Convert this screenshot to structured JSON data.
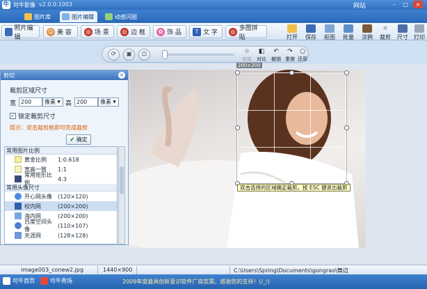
{
  "app": {
    "name": "可牛影像",
    "version": "v2.0.0.1003",
    "site": "网站"
  },
  "tabs": [
    {
      "label": "图片库"
    },
    {
      "label": "图片编辑"
    },
    {
      "label": "动感闪图"
    }
  ],
  "modules": [
    {
      "label": "照片编辑",
      "icon": "photo-edit-icon"
    },
    {
      "label": "美 容",
      "icon": "beauty-icon"
    },
    {
      "label": "场 景",
      "icon": "scene-icon"
    },
    {
      "label": "边 框",
      "icon": "frame-icon"
    },
    {
      "label": "饰 品",
      "icon": "ornament-icon"
    },
    {
      "label": "文 字",
      "icon": "text-icon"
    },
    {
      "label": "多图拼贴",
      "icon": "collage-icon"
    }
  ],
  "actions": [
    {
      "label": "打开",
      "icon": "open-icon"
    },
    {
      "label": "保存",
      "icon": "save-icon"
    },
    {
      "label": "抠图",
      "icon": "cutout-icon"
    },
    {
      "label": "批量",
      "icon": "batch-icon"
    },
    {
      "label": "涂鸦",
      "icon": "graffiti-icon"
    },
    {
      "label": "裁剪",
      "icon": "crop-icon"
    },
    {
      "label": "尺寸",
      "icon": "size-icon"
    },
    {
      "label": "打印",
      "icon": "print-icon"
    }
  ],
  "subtools": [
    {
      "label": "缩放",
      "icon": "zoom-icon"
    },
    {
      "label": "对比",
      "icon": "compare-icon"
    },
    {
      "label": "撤销",
      "icon": "undo-icon"
    },
    {
      "label": "重做",
      "icon": "redo-icon"
    },
    {
      "label": "还原",
      "icon": "restore-icon"
    }
  ],
  "crop": {
    "size_label": "200×200",
    "hint": "双击选择的区域确定裁剪，按 ESC 键退出裁剪"
  },
  "panel": {
    "title": "剪切",
    "section_title": "裁剪区域尺寸",
    "width_label": "宽",
    "width_value": "200",
    "height_label": "高",
    "height_value": "200",
    "unit": "像素",
    "lock_label": "锁定裁剪尺寸",
    "tip": "提示：双击裁剪框即可完成裁剪",
    "ok_label": "确定",
    "groups": [
      {
        "title": "常用图片比例",
        "items": [
          {
            "name": "黄金比例",
            "value": "1:0.618",
            "color": "#f3ef9a"
          },
          {
            "name": "宽高一致",
            "value": "1:1",
            "color": "#f7f3c8"
          },
          {
            "name": "常用矩形比例",
            "value": "4:3",
            "color": "#3a4a7a"
          }
        ]
      },
      {
        "title": "常用头像尺寸",
        "items": [
          {
            "name": "开心网头像",
            "value": "(120×120)",
            "color": "#4a8be0"
          },
          {
            "name": "校内网",
            "value": "(200×200)",
            "color": "#2f5fb0"
          },
          {
            "name": "海内网",
            "value": "(200×200)",
            "color": "#7aa6e0"
          },
          {
            "name": "百度空间头像",
            "value": "(110×107)",
            "color": "#4f7fd0"
          },
          {
            "name": "天涯网",
            "value": "(128×128)",
            "color": "#6c9ad8"
          }
        ]
      }
    ],
    "selected_item": "校内网"
  },
  "status": {
    "filename": "image003_conew2.jpg",
    "dimensions": "1440×900",
    "path": "C:\\Users\\Spring\\Documents\\gongrao\\舞边"
  },
  "bottom": {
    "home": "可牛首页",
    "forum": "可牛秀场",
    "promo": "2009年度最具创新意识软件厂商奖票，感谢您的支持！(/_/)"
  },
  "colors": {
    "accent": "#2f6fc0",
    "tip": "#e05a00",
    "hint_bg": "#ffffc8"
  }
}
